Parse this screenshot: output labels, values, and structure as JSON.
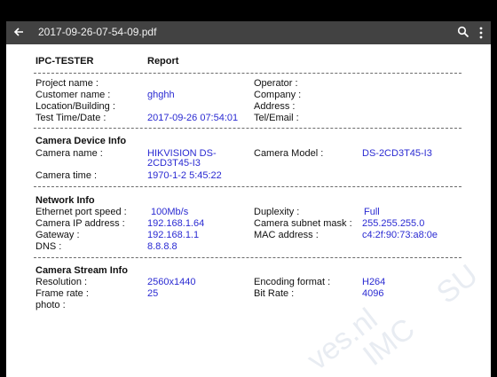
{
  "app_bar": {
    "title": "2017-09-26-07-54-09.pdf"
  },
  "report": {
    "brand": "IPC-TESTER",
    "title": "Report",
    "project": {
      "project_name_label": "Project name :",
      "customer_name_label": "Customer name :",
      "customer_name_value": "ghghh",
      "location_label": "Location/Building :",
      "test_time_label": "Test  Time/Date :",
      "test_time_value": "2017-09-26 07:54:01",
      "operator_label": "Operator :",
      "company_label": "Company :",
      "address_label": "Address :",
      "tel_label": "Tel/Email :"
    },
    "camera_device": {
      "heading": "Camera Device Info",
      "camera_name_label": "Camera name :",
      "camera_name_value_line1": "HIKVISION DS-",
      "camera_name_value_line2": "2CD3T45-I3",
      "camera_model_label": "Camera Model :",
      "camera_model_value": "DS-2CD3T45-I3",
      "camera_time_label": "Camera time :",
      "camera_time_value": "1970-1-2 5:45:22"
    },
    "network": {
      "heading": "Network Info",
      "port_speed_label": "Ethernet port speed :",
      "port_speed_value": "100Mb/s",
      "duplexity_label": "Duplexity :",
      "duplexity_value": "Full",
      "ip_label": "Camera IP address :",
      "ip_value": "192.168.1.64",
      "subnet_label": "Camera subnet mask :",
      "subnet_value": "255.255.255.0",
      "gateway_label": "Gateway :",
      "gateway_value": "192.168.1.1",
      "mac_label": "MAC address :",
      "mac_value": "c4:2f:90:73:a8:0e",
      "dns_label": "DNS :",
      "dns_value": "8.8.8.8"
    },
    "stream": {
      "heading": "Camera Stream Info",
      "resolution_label": "Resolution :",
      "resolution_value": "2560x1440",
      "encoding_label": "Encoding format :",
      "encoding_value": "H264",
      "frame_rate_label": "Frame rate :",
      "frame_rate_value": "25",
      "bit_rate_label": "Bit Rate :",
      "bit_rate_value": "4096",
      "photo_label": "photo :"
    }
  },
  "watermark": {
    "w1": "ves.nl",
    "w2": "IMC",
    "w3": "SU"
  }
}
